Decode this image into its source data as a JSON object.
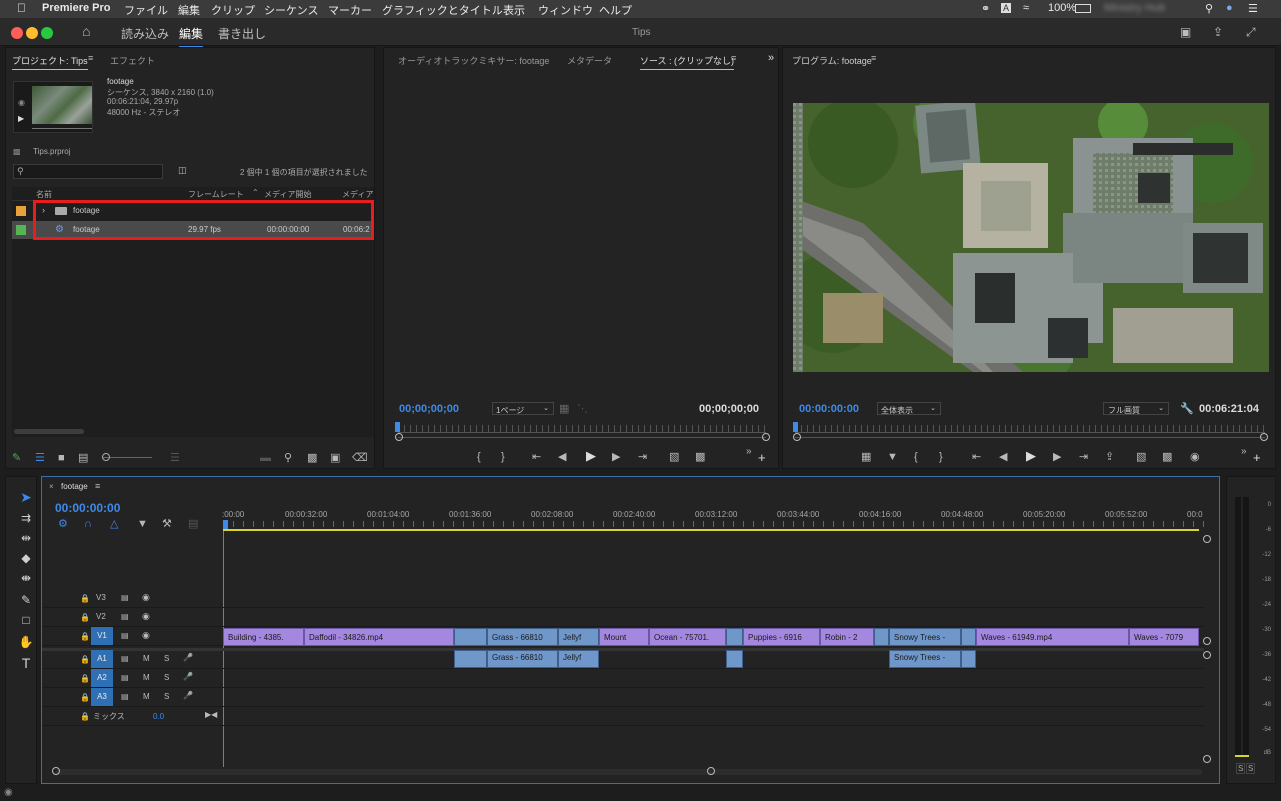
{
  "menubar": {
    "app": "Premiere Pro",
    "items": [
      "ファイル",
      "編集",
      "クリップ",
      "シーケンス",
      "マーカー",
      "グラフィックとタイトル",
      "表示",
      "ウィンドウ",
      "ヘルプ"
    ],
    "battery": "100%",
    "account": "Ministry Hub"
  },
  "titlebar": {
    "workspaces": [
      "読み込み",
      "編集",
      "書き出し"
    ],
    "title": "Tips"
  },
  "project": {
    "tab_active": "プロジェクト: Tips",
    "tab_other": "エフェクト",
    "clip_name": "footage",
    "clip_info": [
      "シーケンス, 3840 x 2160 (1.0)",
      "00:06:21:04, 29.97p",
      "48000 Hz - ステレオ"
    ],
    "project_file": "Tips.prproj",
    "search_placeholder": "",
    "selection_status": "2 個中 1 個の項目が選択されました",
    "columns": [
      "名前",
      "フレームレート",
      "メディア開始",
      "メディア"
    ],
    "rows": [
      {
        "name": "footage",
        "fps": "",
        "start": "",
        "dur": "",
        "color": "#e8a23a"
      },
      {
        "name": "footage",
        "fps": "29.97 fps",
        "start": "00:00:00:00",
        "dur": "00:06:2",
        "color": "#55b453"
      }
    ]
  },
  "source": {
    "tabs": [
      "オーディオトラックミキサー: footage",
      "メタデータ",
      "ソース : (クリップなし)"
    ],
    "tc_left": "00;00;00;00",
    "page": "1ページ",
    "tc_right": "00;00;00;00"
  },
  "program": {
    "tab": "プログラム: footage",
    "tc_left": "00:00:00:00",
    "zoom": "全体表示",
    "quality": "フル画質",
    "tc_right": "00:06:21:04"
  },
  "timeline": {
    "tab": "footage",
    "timecode": "00:00:00:00",
    "ruler": [
      ":00:00",
      "00:00:32:00",
      "00:01:04:00",
      "00:01:36:00",
      "00:02:08:00",
      "00:02:40:00",
      "00:03:12:00",
      "00:03:44:00",
      "00:04:16:00",
      "00:04:48:00",
      "00:05:20:00",
      "00:05:52:00",
      "00:0"
    ],
    "video_tracks": [
      "V3",
      "V2",
      "V1"
    ],
    "audio_tracks": [
      "A1",
      "A2",
      "A3"
    ],
    "mix_label": "ミックス",
    "mix_value": "0.0",
    "track_m": "M",
    "track_s": "S",
    "v1_clips": [
      "Building - 4385.",
      "Daffodil - 34826.mp4",
      "",
      "Grass - 66810",
      "Jellyf",
      "Mount",
      "Ocean - 75701.",
      "",
      "Puppies - 6916",
      "Robin - 2",
      "",
      "Snowy Trees -",
      "",
      "Waves - 61949.mp4",
      "Waves - 7079"
    ],
    "a1_clips": [
      "",
      "Grass - 66810",
      "Jellyf",
      "",
      "Snowy Trees -",
      ""
    ]
  },
  "meter": {
    "levels": [
      "0",
      "-6",
      "-12",
      "-18",
      "-24",
      "-30",
      "-36",
      "-42",
      "-48",
      "-54",
      "dB"
    ],
    "solo": [
      "S",
      "S"
    ]
  }
}
